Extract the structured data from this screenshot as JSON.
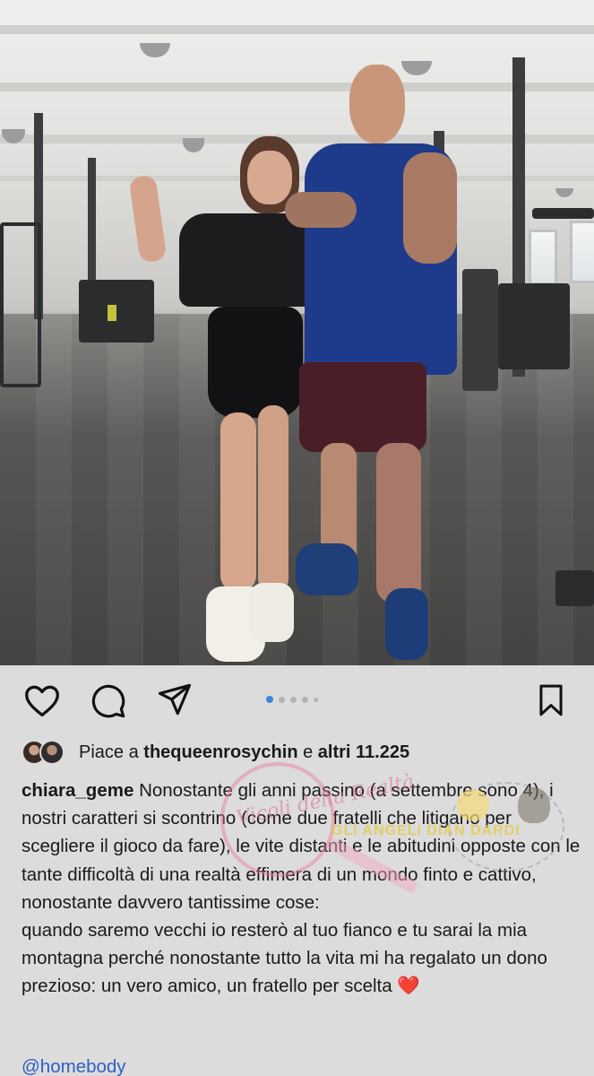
{
  "post": {
    "likes_prefix": "Piace a",
    "likes_user": "thequeenrosychin",
    "likes_mid": "e",
    "likes_count": "altri 11.225",
    "caption_user": "chiara_geme",
    "caption_text": "Nonostante gli anni passino (a settembre sono 4), i nostri caratteri si scontrino (come due fratelli che litigano per scegliere il gioco da fare), le vite distanti e le abitudini opposte con le tante difficoltà di una realtà effimera di un mondo finto e cattivo, nonostante davvero tantissime cose:",
    "caption_text2": "quando saremo vecchi io resterò al tuo fianco e tu sarai la mia montagna perché nonostante tutto la vita mi ha regalato un dono prezioso: un vero amico, un fratello per scelta",
    "caption_emoji": "❤️",
    "mention": "@homebody"
  },
  "carousel": {
    "total": 5,
    "active": 0
  },
  "icons": {
    "like": "heart-icon",
    "comment": "comment-icon",
    "share": "send-icon",
    "save": "bookmark-icon"
  },
  "watermark": {
    "text": "Vicoli della Realtà",
    "small_text": "GLI ANGELI DIAN DARDI"
  },
  "colors": {
    "background": "#dcdcdc",
    "active_dot": "#3b86e0",
    "mention": "#2f5fc4",
    "heart": "#d6202c"
  }
}
